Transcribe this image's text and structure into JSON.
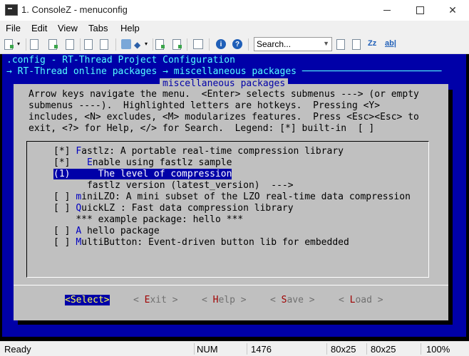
{
  "window": {
    "title": "1. ConsoleZ - menuconfig"
  },
  "menu": [
    "File",
    "Edit",
    "View",
    "Tabs",
    "Help"
  ],
  "toolbar": {
    "search_placeholder": "Search...",
    "zz_label": "Zz",
    "ab_label": "ab|"
  },
  "terminal": {
    "header1": ".config - RT-Thread Project Configuration",
    "header2": "→ RT-Thread online packages → miscellaneous packages ─────────────────────────",
    "dialog_title": "miscellaneous packages",
    "help": [
      "Arrow keys navigate the menu.  <Enter> selects submenus ---> (or empty",
      "submenus ----).  Highlighted letters are hotkeys.  Pressing <Y>",
      "includes, <N> excludes, <M> modularizes features.  Press <Esc><Esc> to",
      "exit, <?> for Help, </> for Search.  Legend: [*] built-in  [ ]"
    ],
    "items": [
      {
        "prefix": "[*] ",
        "hot": "F",
        "rest": "astlz: A portable real-time compression library"
      },
      {
        "prefix": "[*]   ",
        "hot": "E",
        "rest": "nable using fastlz sample"
      },
      {
        "prefix": "(1)",
        "hot": "",
        "rest": "     The level of compression",
        "selected": true
      },
      {
        "prefix": "      ",
        "hot": "",
        "rest": "fastlz version (latest_version)  --->"
      },
      {
        "prefix": "[ ] ",
        "hot": "m",
        "rest": "iniLZO: A mini subset of the LZO real-time data compression"
      },
      {
        "prefix": "[ ] ",
        "hot": "Q",
        "rest": "uickLZ : Fast data compression library"
      },
      {
        "prefix": "    ",
        "hot": "",
        "rest": "*** example package: hello ***"
      },
      {
        "prefix": "[ ] ",
        "hot": "A",
        "rest": " hello package"
      },
      {
        "prefix": "[ ] ",
        "hot": "M",
        "rest": "ultiButton: Event-driven button lib for embedded"
      }
    ],
    "buttons": [
      {
        "pre": "<",
        "hot": "S",
        "rest": "elect>",
        "selected": true
      },
      {
        "pre": "< ",
        "hot": "E",
        "rest": "xit >"
      },
      {
        "pre": "< ",
        "hot": "H",
        "rest": "elp >"
      },
      {
        "pre": "< ",
        "hot": "S",
        "rest": "ave >"
      },
      {
        "pre": "< ",
        "hot": "L",
        "rest": "oad >"
      }
    ]
  },
  "status": {
    "left": "Ready",
    "num": "NUM",
    "value": "1476",
    "size1": "80x25",
    "size2": "80x25",
    "zoom": "100%"
  }
}
